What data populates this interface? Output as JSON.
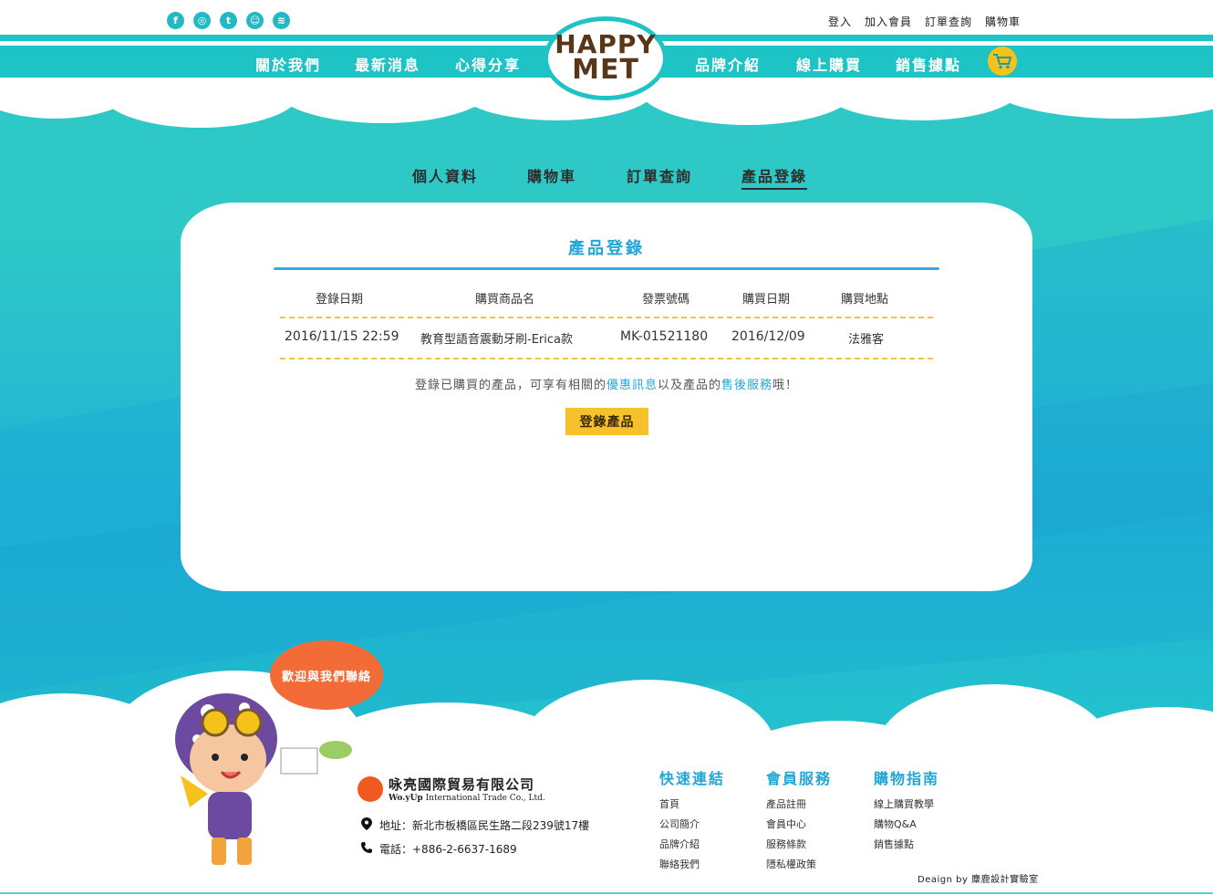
{
  "header": {
    "social_icons": [
      "facebook-icon",
      "instagram-icon",
      "twitter-icon",
      "snapchat-icon",
      "spotify-icon"
    ],
    "top_links": [
      "登入",
      "加入會員",
      "訂單查詢",
      "購物車"
    ],
    "nav_left": [
      "關於我們",
      "最新消息",
      "心得分享"
    ],
    "nav_right": [
      "品牌介紹",
      "線上購買",
      "銷售據點"
    ],
    "logo": {
      "line1": "HAPPY",
      "line2": "MET"
    }
  },
  "subnav": {
    "tabs": [
      "個人資料",
      "購物車",
      "訂單查詢",
      "產品登錄"
    ],
    "active": "產品登錄"
  },
  "panel": {
    "title": "產品登錄",
    "columns": [
      "登錄日期",
      "購買商品名",
      "發票號碼",
      "購買日期",
      "購買地點"
    ],
    "rows": [
      [
        "2016/11/15 22:59",
        "教育型語音震動牙刷-Erica款",
        "MK-01521180",
        "2016/12/09",
        "法雅客"
      ]
    ],
    "note": {
      "p1": "登錄已購買的產品，可享有相關的",
      "link1": "優惠訊息",
      "p2": "以及產品的",
      "link2": "售後服務",
      "p3": "哦！"
    },
    "button": "登錄產品"
  },
  "footer": {
    "bubble": "歡迎與我們聯絡",
    "company_zh": "咏亮國際貿易有限公司",
    "company_en_logo": "Wo.yUp",
    "company_en": "International Trade Co., Ltd.",
    "address": "地址：新北市板橋區民生路二段239號17樓",
    "phone": "電話：+886-2-6637-1689",
    "columns": [
      {
        "title": "快速連結",
        "items": [
          "首頁",
          "公司簡介",
          "品牌介紹",
          "聯絡我們"
        ]
      },
      {
        "title": "會員服務",
        "items": [
          "產品註冊",
          "會員中心",
          "服務條款",
          "隱私權政策"
        ]
      },
      {
        "title": "購物指南",
        "items": [
          "線上購買教學",
          "購物Q&A",
          "銷售據點"
        ]
      }
    ],
    "design_credit": "Deaign by 麋鹿設計實驗室"
  },
  "colors": {
    "teal": "#1ec3c5",
    "accent_blue": "#21a6d8",
    "button_yellow": "#f6c12a",
    "bubble_orange": "#f36b36"
  }
}
